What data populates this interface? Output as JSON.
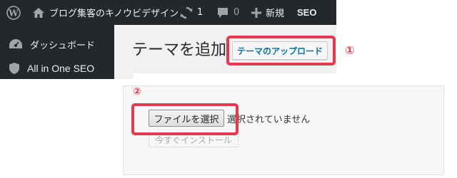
{
  "admin_bar": {
    "site_name": "ブログ集客のキノウビデザイン",
    "updates_count": "1",
    "comments_count": "0",
    "new_label": "新規",
    "seo_label": "SEO"
  },
  "sidebar": {
    "items": [
      {
        "label": "ダッシュボード",
        "icon": "dashboard-icon"
      },
      {
        "label": "All in One SEO",
        "icon": "shield-icon"
      }
    ]
  },
  "page": {
    "title": "テーマを追加",
    "upload_button": "テーマのアップロード"
  },
  "upload_form": {
    "file_button": "ファイルを選択",
    "file_status": "選択されていません",
    "install_button": "今すぐインストール"
  },
  "annotations": {
    "marker_1": "①",
    "marker_2": "②",
    "highlight_color": "#e8384f"
  },
  "colors": {
    "admin_bar": "#23282d",
    "link_blue": "#0073aa"
  }
}
